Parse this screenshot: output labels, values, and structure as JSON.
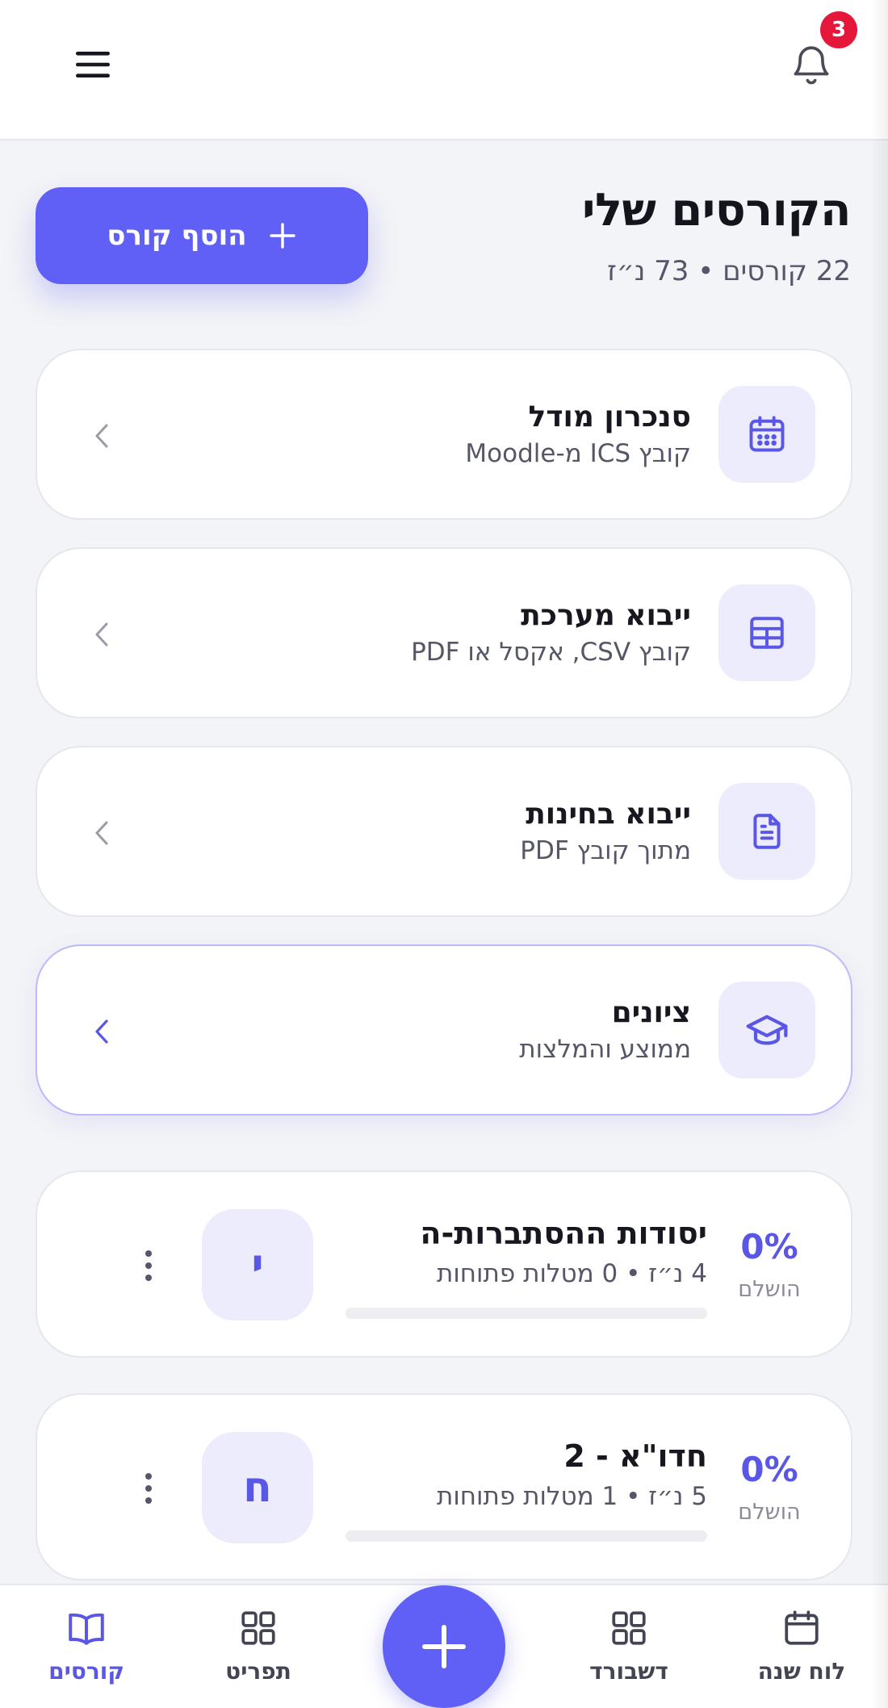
{
  "topbar": {
    "notification_count": "3",
    "bell_icon": "bell-icon",
    "menu_icon": "hamburger-menu-icon"
  },
  "header": {
    "title": "הקורסים שלי",
    "subtitle": "22 קורסים • 73 נ״ז",
    "add_button_label": "הוסף קורס",
    "add_button_icon": "plus-icon"
  },
  "tools": [
    {
      "title": "סנכרון מודל",
      "subtitle": "קובץ ICS מ-Moodle",
      "icon": "calendar-icon"
    },
    {
      "title": "ייבוא מערכת",
      "subtitle": "קובץ CSV, אקסל או PDF",
      "icon": "table-icon"
    },
    {
      "title": "ייבוא בחינות",
      "subtitle": "מתוך קובץ PDF",
      "icon": "document-icon"
    },
    {
      "title": "ציונים",
      "subtitle": "ממוצע והמלצות",
      "icon": "graduation-cap-icon"
    }
  ],
  "courses": [
    {
      "title": "יסודות ההסתברות-ה",
      "meta": "4 נ״ז • 0 מטלות פתוחות",
      "percent": "0%",
      "percent_label": "הושלם",
      "progress": 0,
      "avatar_letter": "י"
    },
    {
      "title": "חדו\"א - 2",
      "meta": "5 נ״ז • 1 מטלות פתוחות",
      "percent": "0%",
      "percent_label": "הושלם",
      "progress": 0,
      "avatar_letter": "ח"
    }
  ],
  "bottom_nav": {
    "items": [
      {
        "label": "לוח שנה",
        "icon": "calendar-icon",
        "active": false
      },
      {
        "label": "דשבורד",
        "icon": "dashboard-icon",
        "active": false
      },
      {
        "label": "תפריט",
        "icon": "grid-icon",
        "active": false
      },
      {
        "label": "קורסים",
        "icon": "book-icon",
        "active": true
      }
    ],
    "fab_icon": "plus-icon"
  },
  "colors": {
    "accent": "#6160f6",
    "badge": "#e5183b",
    "background": "#f3f4f7",
    "card": "#ffffff",
    "icon_tile": "#ececfc"
  }
}
